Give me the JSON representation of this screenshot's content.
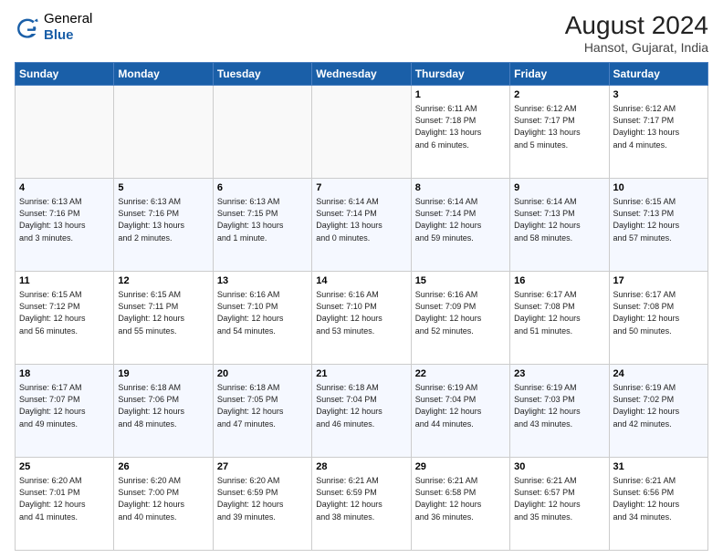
{
  "header": {
    "logo": {
      "general": "General",
      "blue": "Blue"
    },
    "title": "August 2024",
    "location": "Hansot, Gujarat, India"
  },
  "weekdays": [
    "Sunday",
    "Monday",
    "Tuesday",
    "Wednesday",
    "Thursday",
    "Friday",
    "Saturday"
  ],
  "weeks": [
    [
      {
        "day": "",
        "info": ""
      },
      {
        "day": "",
        "info": ""
      },
      {
        "day": "",
        "info": ""
      },
      {
        "day": "",
        "info": ""
      },
      {
        "day": "1",
        "info": "Sunrise: 6:11 AM\nSunset: 7:18 PM\nDaylight: 13 hours\nand 6 minutes."
      },
      {
        "day": "2",
        "info": "Sunrise: 6:12 AM\nSunset: 7:17 PM\nDaylight: 13 hours\nand 5 minutes."
      },
      {
        "day": "3",
        "info": "Sunrise: 6:12 AM\nSunset: 7:17 PM\nDaylight: 13 hours\nand 4 minutes."
      }
    ],
    [
      {
        "day": "4",
        "info": "Sunrise: 6:13 AM\nSunset: 7:16 PM\nDaylight: 13 hours\nand 3 minutes."
      },
      {
        "day": "5",
        "info": "Sunrise: 6:13 AM\nSunset: 7:16 PM\nDaylight: 13 hours\nand 2 minutes."
      },
      {
        "day": "6",
        "info": "Sunrise: 6:13 AM\nSunset: 7:15 PM\nDaylight: 13 hours\nand 1 minute."
      },
      {
        "day": "7",
        "info": "Sunrise: 6:14 AM\nSunset: 7:14 PM\nDaylight: 13 hours\nand 0 minutes."
      },
      {
        "day": "8",
        "info": "Sunrise: 6:14 AM\nSunset: 7:14 PM\nDaylight: 12 hours\nand 59 minutes."
      },
      {
        "day": "9",
        "info": "Sunrise: 6:14 AM\nSunset: 7:13 PM\nDaylight: 12 hours\nand 58 minutes."
      },
      {
        "day": "10",
        "info": "Sunrise: 6:15 AM\nSunset: 7:13 PM\nDaylight: 12 hours\nand 57 minutes."
      }
    ],
    [
      {
        "day": "11",
        "info": "Sunrise: 6:15 AM\nSunset: 7:12 PM\nDaylight: 12 hours\nand 56 minutes."
      },
      {
        "day": "12",
        "info": "Sunrise: 6:15 AM\nSunset: 7:11 PM\nDaylight: 12 hours\nand 55 minutes."
      },
      {
        "day": "13",
        "info": "Sunrise: 6:16 AM\nSunset: 7:10 PM\nDaylight: 12 hours\nand 54 minutes."
      },
      {
        "day": "14",
        "info": "Sunrise: 6:16 AM\nSunset: 7:10 PM\nDaylight: 12 hours\nand 53 minutes."
      },
      {
        "day": "15",
        "info": "Sunrise: 6:16 AM\nSunset: 7:09 PM\nDaylight: 12 hours\nand 52 minutes."
      },
      {
        "day": "16",
        "info": "Sunrise: 6:17 AM\nSunset: 7:08 PM\nDaylight: 12 hours\nand 51 minutes."
      },
      {
        "day": "17",
        "info": "Sunrise: 6:17 AM\nSunset: 7:08 PM\nDaylight: 12 hours\nand 50 minutes."
      }
    ],
    [
      {
        "day": "18",
        "info": "Sunrise: 6:17 AM\nSunset: 7:07 PM\nDaylight: 12 hours\nand 49 minutes."
      },
      {
        "day": "19",
        "info": "Sunrise: 6:18 AM\nSunset: 7:06 PM\nDaylight: 12 hours\nand 48 minutes."
      },
      {
        "day": "20",
        "info": "Sunrise: 6:18 AM\nSunset: 7:05 PM\nDaylight: 12 hours\nand 47 minutes."
      },
      {
        "day": "21",
        "info": "Sunrise: 6:18 AM\nSunset: 7:04 PM\nDaylight: 12 hours\nand 46 minutes."
      },
      {
        "day": "22",
        "info": "Sunrise: 6:19 AM\nSunset: 7:04 PM\nDaylight: 12 hours\nand 44 minutes."
      },
      {
        "day": "23",
        "info": "Sunrise: 6:19 AM\nSunset: 7:03 PM\nDaylight: 12 hours\nand 43 minutes."
      },
      {
        "day": "24",
        "info": "Sunrise: 6:19 AM\nSunset: 7:02 PM\nDaylight: 12 hours\nand 42 minutes."
      }
    ],
    [
      {
        "day": "25",
        "info": "Sunrise: 6:20 AM\nSunset: 7:01 PM\nDaylight: 12 hours\nand 41 minutes."
      },
      {
        "day": "26",
        "info": "Sunrise: 6:20 AM\nSunset: 7:00 PM\nDaylight: 12 hours\nand 40 minutes."
      },
      {
        "day": "27",
        "info": "Sunrise: 6:20 AM\nSunset: 6:59 PM\nDaylight: 12 hours\nand 39 minutes."
      },
      {
        "day": "28",
        "info": "Sunrise: 6:21 AM\nSunset: 6:59 PM\nDaylight: 12 hours\nand 38 minutes."
      },
      {
        "day": "29",
        "info": "Sunrise: 6:21 AM\nSunset: 6:58 PM\nDaylight: 12 hours\nand 36 minutes."
      },
      {
        "day": "30",
        "info": "Sunrise: 6:21 AM\nSunset: 6:57 PM\nDaylight: 12 hours\nand 35 minutes."
      },
      {
        "day": "31",
        "info": "Sunrise: 6:21 AM\nSunset: 6:56 PM\nDaylight: 12 hours\nand 34 minutes."
      }
    ]
  ]
}
